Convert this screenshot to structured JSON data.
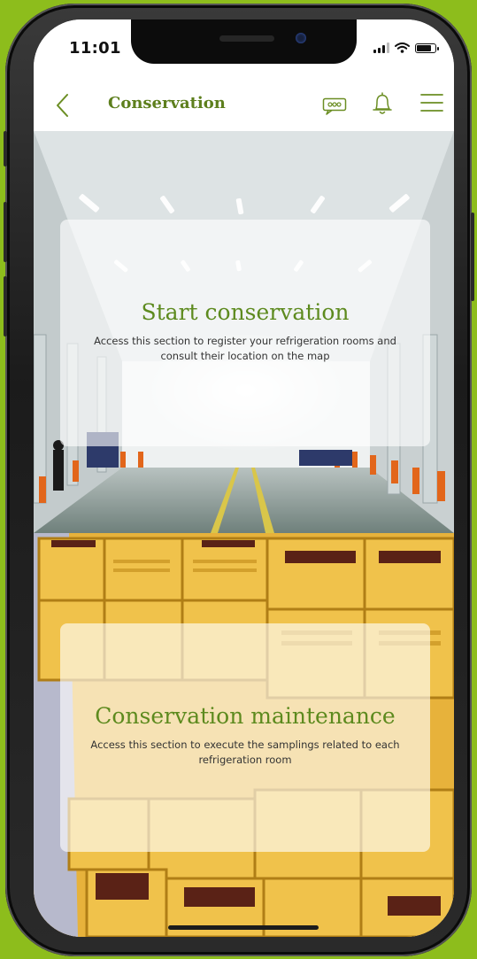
{
  "status_bar": {
    "time": "11:01"
  },
  "header": {
    "title": "Conservation",
    "icons": [
      "back-chevron-icon",
      "chat-icon",
      "bell-icon",
      "menu-icon"
    ]
  },
  "sections": [
    {
      "title": "Start conservation",
      "description": "Access this section to register your refrigeration rooms and consult their location on the map"
    },
    {
      "title": "Conservation maintenance",
      "description": "Access this section to execute the samplings related to each refrigeration room"
    }
  ],
  "colors": {
    "background": "#8dbd1c",
    "accent": "#5d8a1e",
    "header_title": "#5d7f1d"
  }
}
